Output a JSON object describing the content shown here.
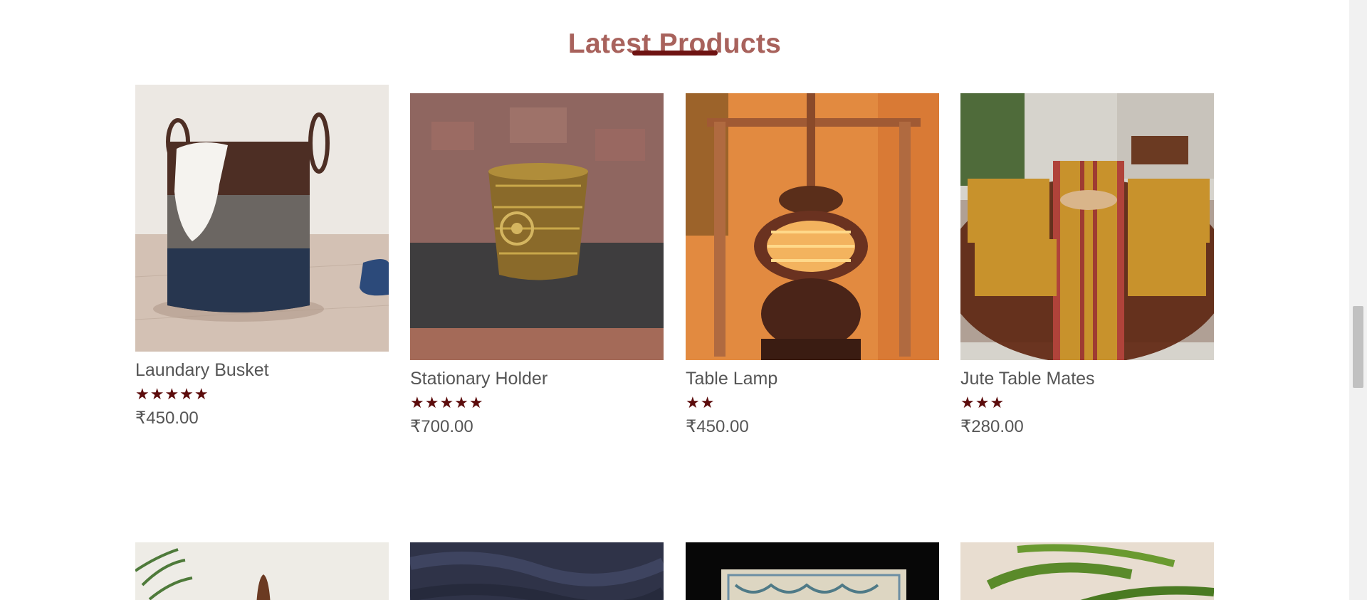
{
  "section": {
    "title": "Latest Products"
  },
  "products": [
    {
      "name": "Laundary Busket",
      "rating": 5,
      "stars": "★★★★★",
      "price": "₹450.00"
    },
    {
      "name": "Stationary Holder",
      "rating": 5,
      "stars": "★★★★★",
      "price": "₹700.00"
    },
    {
      "name": "Table Lamp",
      "rating": 2,
      "stars": "★★",
      "price": "₹450.00"
    },
    {
      "name": "Jute Table Mates",
      "rating": 3,
      "stars": "★★★",
      "price": "₹280.00"
    }
  ],
  "colors": {
    "title": "#a8625c",
    "accent": "#6e1312",
    "star": "#5c0c0c",
    "text": "#555555"
  }
}
